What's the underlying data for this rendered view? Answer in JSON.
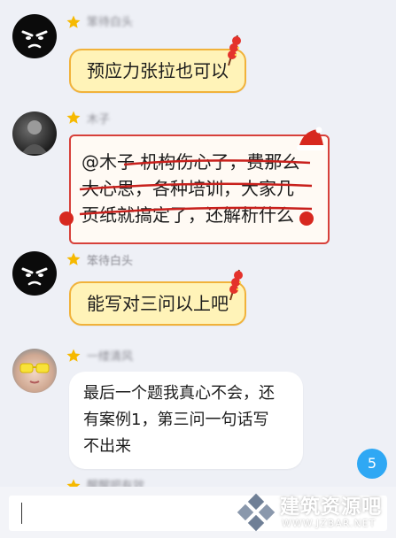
{
  "messages": [
    {
      "sender": "笨待白头",
      "text": "预应力张拉也可以"
    },
    {
      "sender": "木子",
      "text_lines": [
        "@木子 机构伤心了，费那么",
        "大心思，各种培训，大家几",
        "页纸就搞定了，还解析什么"
      ]
    },
    {
      "sender": "笨待白头",
      "text": "能写对三问以上吧"
    },
    {
      "sender": "一缕清风",
      "text_lines": [
        "最后一个题我真心不会，还",
        "有案例1，第三问一句话写",
        "不出来"
      ]
    },
    {
      "sender": "醒醒吧有效"
    }
  ],
  "unread_badge": "5",
  "watermark": {
    "name": "建筑资源吧",
    "url": "WWW.JZBAR.NET"
  },
  "icons": {
    "star": "star-icon",
    "lantern": "lantern-icon",
    "hat": "santa-hat-icon",
    "logo": "diamond-logo-icon"
  },
  "colors": {
    "bubble_yellow": "#fff3b8",
    "bubble_yellow_border": "#f1b23a",
    "bubble_red_border": "#d7403a",
    "badge": "#2fa8f4",
    "background": "#eef0f6"
  }
}
